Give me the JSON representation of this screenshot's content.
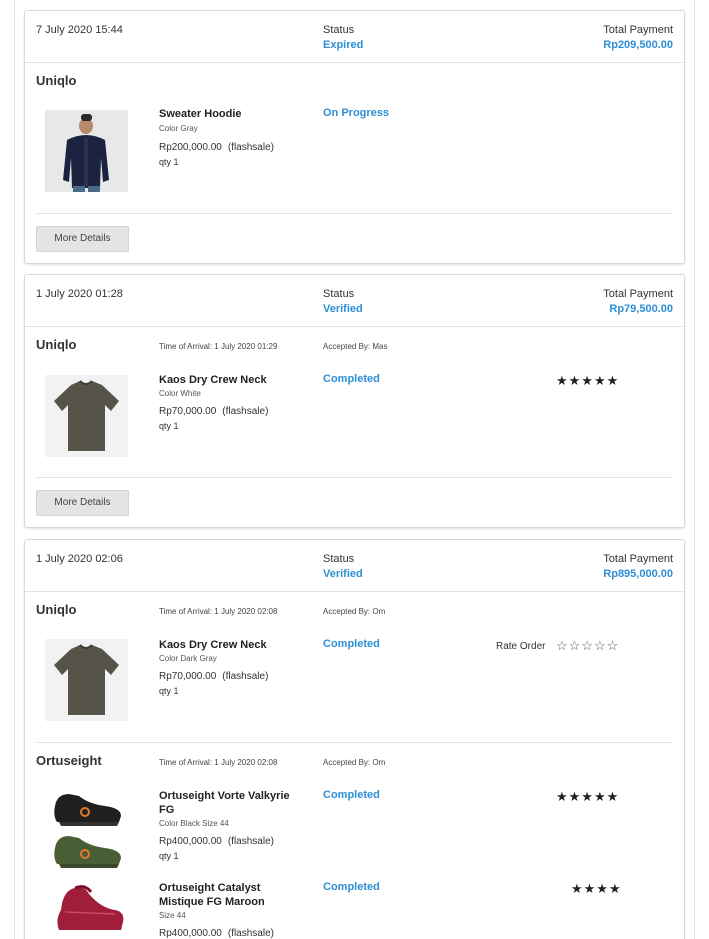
{
  "orders": [
    {
      "date": "7 July 2020 15:44",
      "status_label": "Status",
      "status": "Expired",
      "total_label": "Total Payment",
      "total": "Rp209,500.00",
      "stores": [
        {
          "name": "Uniqlo",
          "items": [
            {
              "name": "Sweater Hoodie",
              "variant": "Color Gray",
              "price": "Rp200,000.00",
              "price_tag": "(flashsale)",
              "qty": "qty 1",
              "status": "On Progress",
              "image": "hoodie-photo"
            }
          ]
        }
      ],
      "more_details": "More Details"
    },
    {
      "date": "1 July 2020 01:28",
      "status_label": "Status",
      "status": "Verified",
      "total_label": "Total Payment",
      "total": "Rp79,500.00",
      "stores": [
        {
          "name": "Uniqlo",
          "arrival": "Time of Arrival: 1 July 2020 01:29",
          "accepted": "Accepted By: Mas",
          "items": [
            {
              "name": "Kaos Dry Crew Neck",
              "variant": "Color White",
              "price": "Rp70,000.00",
              "price_tag": "(flashsale)",
              "qty": "qty 1",
              "status": "Completed",
              "rating": "★★★★★",
              "image": "tshirt-photo"
            }
          ]
        }
      ],
      "more_details": "More Details"
    },
    {
      "date": "1 July 2020 02:06",
      "status_label": "Status",
      "status": "Verified",
      "total_label": "Total Payment",
      "total": "Rp895,000.00",
      "stores": [
        {
          "name": "Uniqlo",
          "arrival": "Time of Arrival: 1 July 2020 02:08",
          "accepted": "Accepted By: Om",
          "items": [
            {
              "name": "Kaos Dry Crew Neck",
              "variant": "Color Dark Gray",
              "price": "Rp70,000.00",
              "price_tag": "(flashsale)",
              "qty": "qty 1",
              "status": "Completed",
              "rate_label": "Rate Order",
              "rating_empty": "☆☆☆☆☆",
              "image": "tshirt-photo"
            }
          ]
        },
        {
          "name": "Ortuseight",
          "arrival": "Time of Arrival: 1 July 2020 02:08",
          "accepted": "Accepted By: Om",
          "items": [
            {
              "name": "Ortuseight Vorte Valkyrie FG",
              "variant": "Color Black  Size 44",
              "price": "Rp400,000.00",
              "price_tag": "(flashsale)",
              "qty": "qty 1",
              "status": "Completed",
              "rating": "★★★★★",
              "image": "boot-photo"
            },
            {
              "name": "Ortuseight Catalyst Mistique FG Maroon",
              "variant": "Size 44",
              "price": "Rp400,000.00",
              "price_tag": "(flashsale)",
              "status": "Completed",
              "rating": "★★★★",
              "image": "boot-maroon-photo"
            }
          ]
        }
      ]
    }
  ],
  "colors": {
    "accent": "#2d8fd5",
    "border": "#d9d9d9",
    "button": "#e4e4e4"
  }
}
